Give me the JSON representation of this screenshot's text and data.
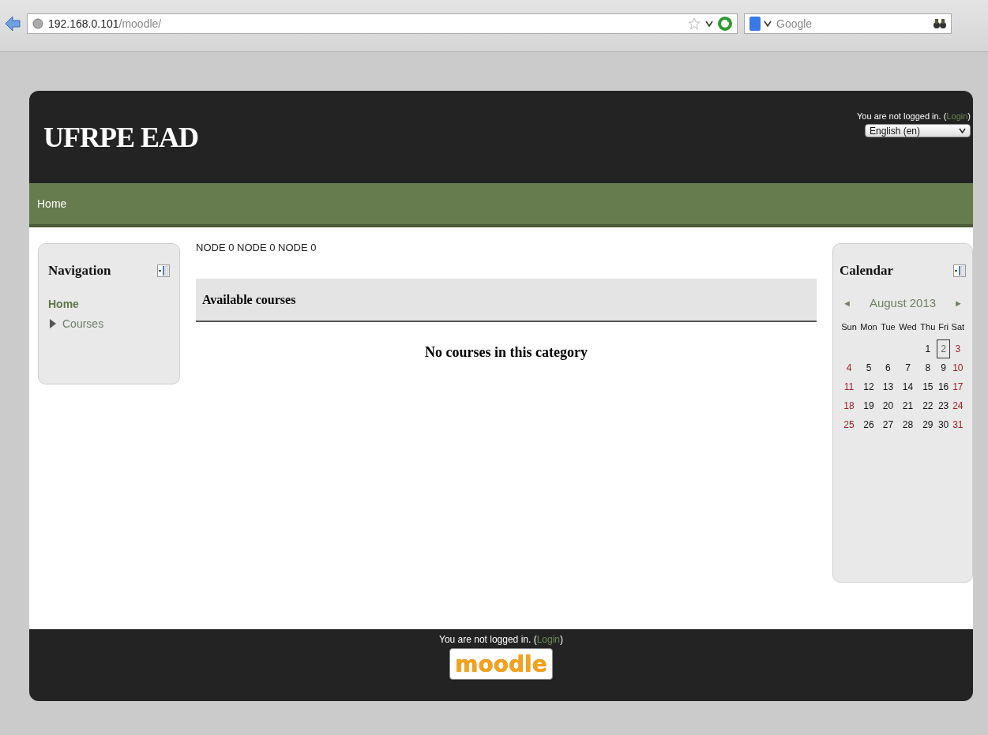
{
  "browser": {
    "url_host": "192.168.0.101",
    "url_path": "/moodle/",
    "search": {
      "placeholder": "Google"
    }
  },
  "header": {
    "site_title": "UFRPE EAD",
    "login_info": {
      "text": "You are not logged in. (",
      "link": "Login",
      "close": ")"
    },
    "language": {
      "value": "English (en)"
    }
  },
  "navbar": {
    "items": [
      {
        "label": "Home"
      }
    ]
  },
  "navigation": {
    "title": "Navigation",
    "items": [
      {
        "label": "Home",
        "kind": "link"
      },
      {
        "label": "Courses",
        "kind": "branch",
        "expanded": false
      }
    ]
  },
  "main": {
    "breadcrumb": "NODE 0 NODE 0 NODE 0",
    "heading": "Available courses",
    "message": "No courses in this category"
  },
  "calendar": {
    "title": "Calendar",
    "prev": "◄",
    "month": "August 2013",
    "next": "►",
    "weekdays": [
      "Sun",
      "Mon",
      "Tue",
      "Wed",
      "Thu",
      "Fri",
      "Sat"
    ],
    "weeks": [
      [
        {
          "kind": "blank"
        },
        {
          "kind": "blank"
        },
        {
          "kind": "blank"
        },
        {
          "kind": "blank"
        },
        {
          "kind": "weekday",
          "day": "1",
          "today": false
        },
        {
          "kind": "weekday",
          "day": "2",
          "today": true
        },
        {
          "kind": "weekend",
          "day": "3",
          "today": false
        }
      ],
      [
        {
          "kind": "weekend",
          "day": "4",
          "today": false
        },
        {
          "kind": "weekday",
          "day": "5",
          "today": false
        },
        {
          "kind": "weekday",
          "day": "6",
          "today": false
        },
        {
          "kind": "weekday",
          "day": "7",
          "today": false
        },
        {
          "kind": "weekday",
          "day": "8",
          "today": false
        },
        {
          "kind": "weekday",
          "day": "9",
          "today": false
        },
        {
          "kind": "weekend",
          "day": "10",
          "today": false
        }
      ],
      [
        {
          "kind": "weekend",
          "day": "11",
          "today": false
        },
        {
          "kind": "weekday",
          "day": "12",
          "today": false
        },
        {
          "kind": "weekday",
          "day": "13",
          "today": false
        },
        {
          "kind": "weekday",
          "day": "14",
          "today": false
        },
        {
          "kind": "weekday",
          "day": "15",
          "today": false
        },
        {
          "kind": "weekday",
          "day": "16",
          "today": false
        },
        {
          "kind": "weekend",
          "day": "17",
          "today": false
        }
      ],
      [
        {
          "kind": "weekend",
          "day": "18",
          "today": false
        },
        {
          "kind": "weekday",
          "day": "19",
          "today": false
        },
        {
          "kind": "weekday",
          "day": "20",
          "today": false
        },
        {
          "kind": "weekday",
          "day": "21",
          "today": false
        },
        {
          "kind": "weekday",
          "day": "22",
          "today": false
        },
        {
          "kind": "weekday",
          "day": "23",
          "today": false
        },
        {
          "kind": "weekend",
          "day": "24",
          "today": false
        }
      ],
      [
        {
          "kind": "weekend",
          "day": "25",
          "today": false
        },
        {
          "kind": "weekday",
          "day": "26",
          "today": false
        },
        {
          "kind": "weekday",
          "day": "27",
          "today": false
        },
        {
          "kind": "weekday",
          "day": "28",
          "today": false
        },
        {
          "kind": "weekday",
          "day": "29",
          "today": false
        },
        {
          "kind": "weekday",
          "day": "30",
          "today": false
        },
        {
          "kind": "weekend",
          "day": "31",
          "today": false
        }
      ]
    ]
  },
  "footer": {
    "login_info": {
      "text": "You are not logged in. (",
      "link": "Login",
      "close": ")"
    },
    "logo_text": "moodle"
  }
}
